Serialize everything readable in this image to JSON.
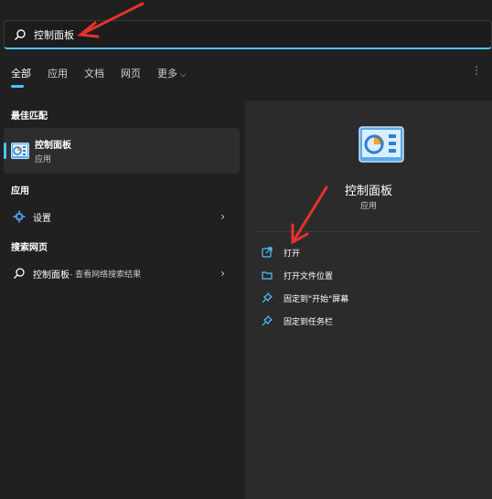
{
  "search": {
    "query": "控制面板"
  },
  "tabs": [
    {
      "label": "全部",
      "active": true
    },
    {
      "label": "应用",
      "active": false
    },
    {
      "label": "文档",
      "active": false
    },
    {
      "label": "网页",
      "active": false
    },
    {
      "label": "更多",
      "active": false
    }
  ],
  "sections": {
    "best_match_title": "最佳匹配",
    "apps_title": "应用",
    "web_title": "搜索网页"
  },
  "best_match": {
    "name": "控制面板",
    "type": "应用",
    "icon": "control-panel-icon"
  },
  "apps": [
    {
      "label": "设置",
      "icon": "gear-icon"
    }
  ],
  "web": {
    "label": "控制面板",
    "sub": " - 查看网络搜索结果",
    "icon": "search-icon"
  },
  "detail": {
    "name": "控制面板",
    "type": "应用",
    "actions": [
      {
        "label": "打开",
        "icon": "open-icon"
      },
      {
        "label": "打开文件位置",
        "icon": "folder-icon"
      },
      {
        "label": "固定到\"开始\"屏幕",
        "icon": "pin-icon"
      },
      {
        "label": "固定到任务栏",
        "icon": "pin-icon"
      }
    ]
  },
  "colors": {
    "background": "#202020",
    "panel": "#2b2b2b",
    "accent": "#4cc2ff",
    "arrow": "#e5322d"
  }
}
